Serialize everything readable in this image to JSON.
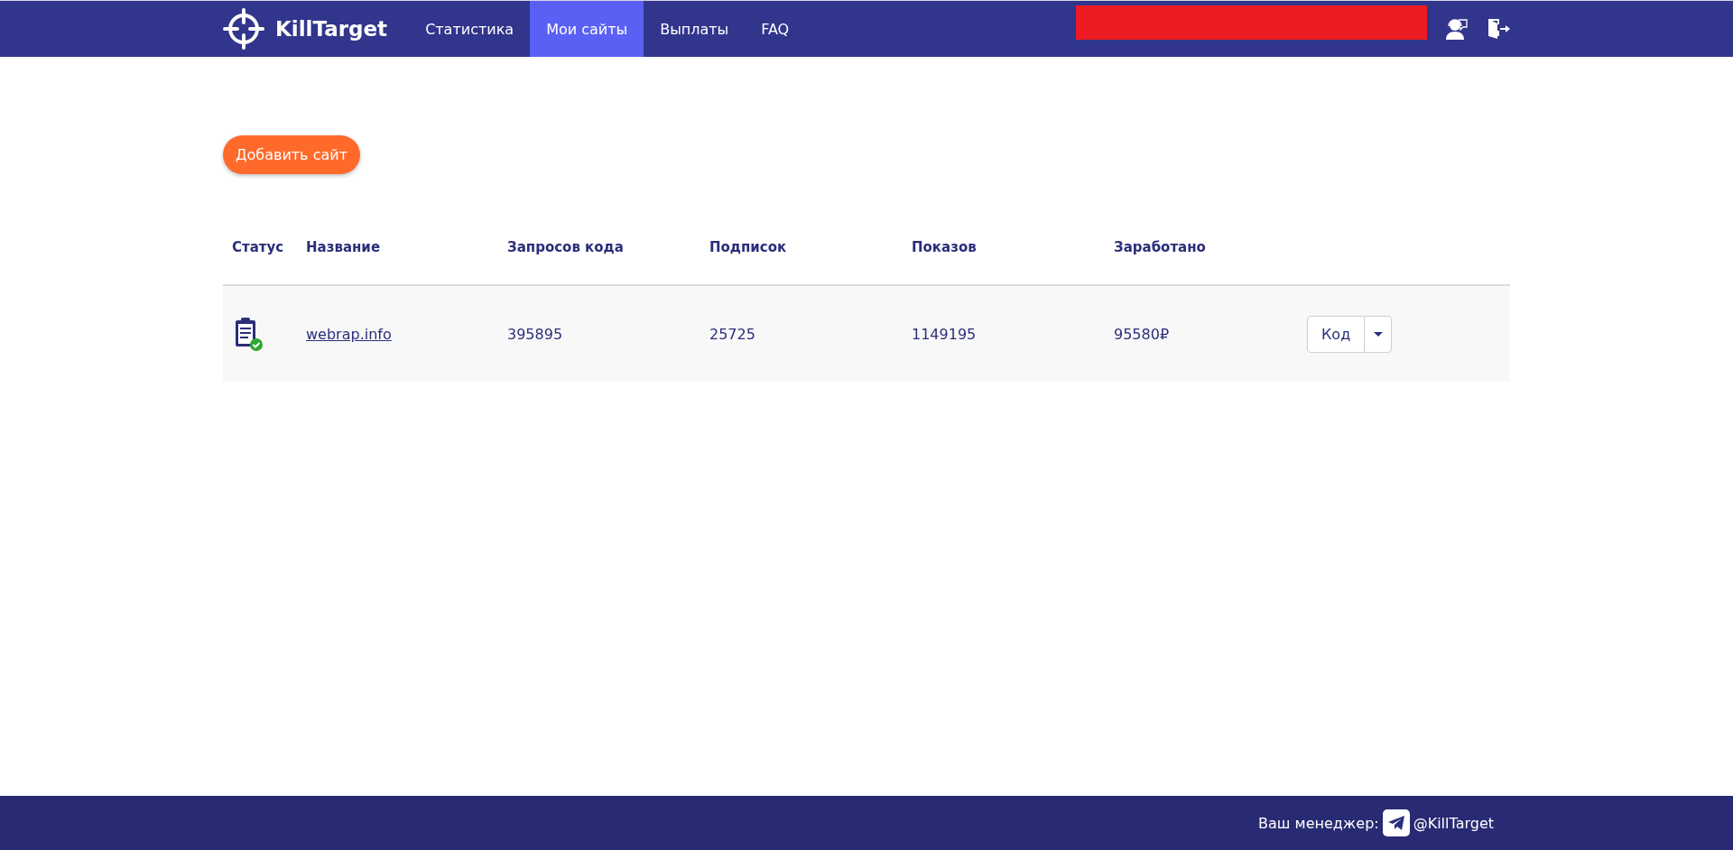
{
  "header": {
    "logo": "KillTarget",
    "nav": [
      {
        "label": "Статистика",
        "selected": false
      },
      {
        "label": "Мои сайты",
        "selected": true
      },
      {
        "label": "Выплаты",
        "selected": false
      },
      {
        "label": "FAQ",
        "selected": false
      }
    ]
  },
  "add_button": "Добавить сайт",
  "table": {
    "columns": [
      "Статус",
      "Название",
      "Запросов кода",
      "Подписок",
      "Показов",
      "Заработано"
    ],
    "rows": [
      {
        "verified": true,
        "name": "webrap.info",
        "code_requests": "395895",
        "subscriptions": "25725",
        "impressions": "1149195",
        "earned": "95580₽",
        "action": "Код"
      }
    ]
  },
  "footer": {
    "label": "Ваш менеджер:",
    "handle": "@KillTarget"
  }
}
